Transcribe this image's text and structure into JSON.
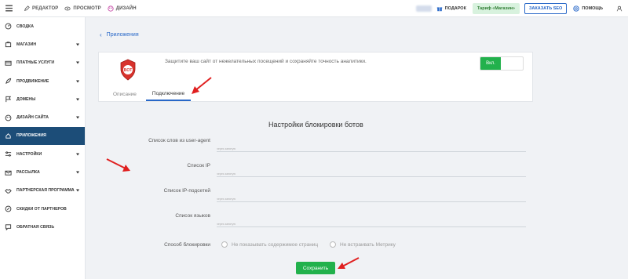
{
  "topbar": {
    "editor": "РЕДАКТОР",
    "preview": "ПРОСМОТР",
    "design": "ДИЗАЙН",
    "gifts": "ПОДАРОК",
    "tariff": "Тариф «Магазин»",
    "order_seo": "ЗАКАЗАТЬ SEO",
    "help": "ПОМОЩЬ"
  },
  "sidebar": {
    "items": [
      {
        "label": "СВОДКА",
        "icon": "dashboard-icon",
        "caret": false
      },
      {
        "label": "МАГАЗИН",
        "icon": "shop-icon",
        "caret": true
      },
      {
        "label": "ПЛАТНЫЕ УСЛУГИ",
        "icon": "card-icon",
        "caret": true
      },
      {
        "label": "ПРОДВИЖЕНИЕ",
        "icon": "rocket-icon",
        "caret": true
      },
      {
        "label": "ДОМЕНЫ",
        "icon": "flag-icon",
        "caret": true
      },
      {
        "label": "ДИЗАЙН САЙТА",
        "icon": "palette-icon",
        "caret": true
      },
      {
        "label": "ПРИЛОЖЕНИЯ",
        "icon": "apps-icon",
        "caret": false,
        "active": true
      },
      {
        "label": "НАСТРОЙКИ",
        "icon": "sliders-icon",
        "caret": true
      },
      {
        "label": "РАССЫЛКА",
        "icon": "mail-icon",
        "caret": true
      },
      {
        "label": "ПАРТНЕРСКАЯ ПРОГРАММА",
        "icon": "handshake-icon",
        "caret": true
      },
      {
        "label": "СКИДКИ ОТ ПАРТНЕРОВ",
        "icon": "discount-icon",
        "caret": false
      },
      {
        "label": "ОБРАТНАЯ СВЯЗЬ",
        "icon": "chat-icon",
        "caret": false
      }
    ]
  },
  "main": {
    "back_label": "Приложения",
    "card": {
      "logo_text": "BOT",
      "description": "Защитите ваш сайт от нежелательных посещений и сохраняйте точность аналитики.",
      "toggle_label": "Вкл.",
      "tabs": [
        "Описание",
        "Подключение"
      ]
    },
    "section_title": "Настройки блокировки ботов",
    "fields": [
      {
        "label": "Список слов из user-agent",
        "hint": "через запятую"
      },
      {
        "label": "Список IP",
        "hint": "через запятую"
      },
      {
        "label": "Список IP-подсетей",
        "hint": "через запятую"
      },
      {
        "label": "Список языков",
        "hint": "через запятую"
      }
    ],
    "method": {
      "label": "Способ блокировки",
      "options": [
        "Не показывать содержимое страниц",
        "Не встраивать Метрику"
      ]
    },
    "save_label": "Сохранить"
  },
  "colors": {
    "accent": "#2868c8",
    "sidebar_active": "#1c4d78",
    "green": "#22b14c",
    "arrow": "#e02020"
  }
}
